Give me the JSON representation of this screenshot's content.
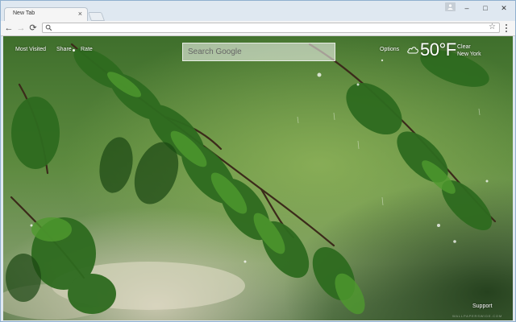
{
  "tab": {
    "title": "New Tab",
    "close_glyph": "×"
  },
  "window_controls": {
    "minimize": "–",
    "maximize": "□",
    "close": "✕"
  },
  "toolbar": {
    "back": "←",
    "forward": "→",
    "reload": "⟳",
    "address_value": "",
    "star": "☆"
  },
  "page": {
    "links": {
      "most_visited": "Most Visited",
      "share": "Share",
      "rate": "Rate",
      "options": "Options"
    },
    "search": {
      "placeholder": "Search Google"
    },
    "weather": {
      "temperature": "50°F",
      "condition": "Clear",
      "city": "New York",
      "icon": "cloud-icon"
    },
    "support": "Support",
    "watermark": "WALLPAPERSWIDE.COM"
  },
  "colors": {
    "frame": "#dfe8f1",
    "toolbar": "#f5f5f5",
    "foliage": "#2e6b1f"
  }
}
